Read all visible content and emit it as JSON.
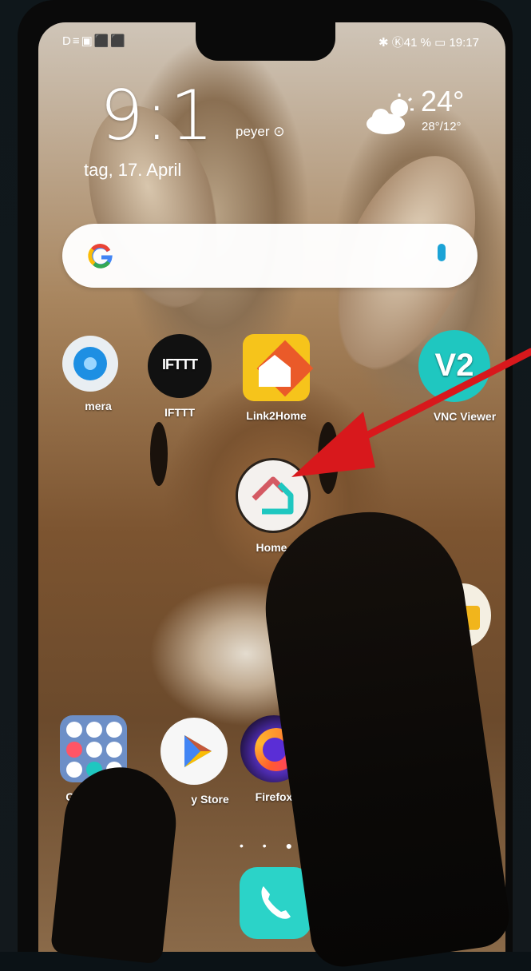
{
  "status_bar": {
    "left_icons": "D≡▣⬛⬛",
    "right": "✱ Ⓚ41 % ▭ 19:17"
  },
  "lockscreen": {
    "clock": "9:1",
    "location": "peyer",
    "date": "tag, 17. April",
    "temperature": "24°",
    "temp_range": "28°/12°"
  },
  "search": {
    "logo": "G"
  },
  "apps": [
    {
      "label": "mera",
      "icon": "camera-icon"
    },
    {
      "label": "IFTTT",
      "icon": "ifttt-icon"
    },
    {
      "label": "Link2Home",
      "icon": "link2home-icon"
    },
    {
      "label": "VNC Viewer",
      "icon": "vnc-viewer-icon",
      "badge": "V2"
    },
    {
      "label": "Home",
      "icon": "home-app-icon"
    },
    {
      "label": "Go",
      "icon": "folder-icon"
    },
    {
      "label": "y Store",
      "icon": "play-store-icon"
    },
    {
      "label": "Firefox",
      "icon": "firefox-icon"
    }
  ],
  "colors": {
    "arrow": "#d8181c",
    "teal": "#1fc7c0",
    "accent_blue": "#1ca3d6"
  }
}
